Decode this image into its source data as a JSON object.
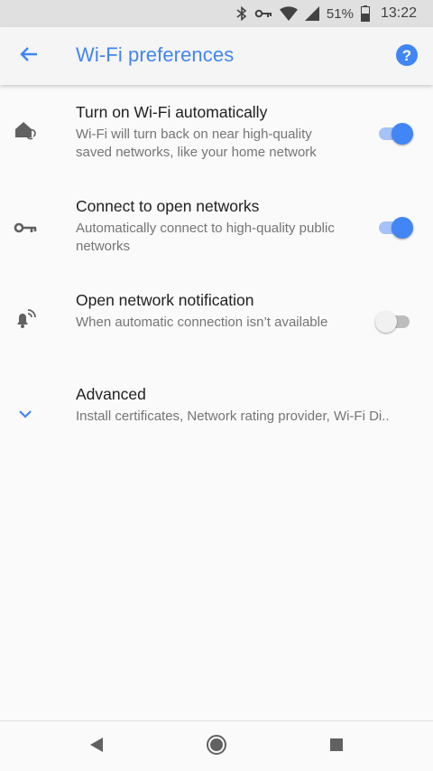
{
  "status_bar": {
    "battery_percent": "51%",
    "time": "13:22",
    "icons": [
      "bluetooth-icon",
      "vpn-key-icon",
      "wifi-icon",
      "signal-icon",
      "battery-icon"
    ]
  },
  "app_bar": {
    "title": "Wi-Fi preferences",
    "back_icon": "arrow-back-icon",
    "help_icon": "help-icon",
    "accent_color": "#4285f4"
  },
  "settings": [
    {
      "icon": "home-wifi-icon",
      "title": "Turn on Wi-Fi automatically",
      "summary": "Wi-Fi will turn back on near high-quality saved networks, like your home network",
      "switch_on": true
    },
    {
      "icon": "key-icon",
      "title": "Connect to open networks",
      "summary": "Automatically connect to high-quality public networks",
      "switch_on": true
    },
    {
      "icon": "notification-wifi-icon",
      "title": "Open network notification",
      "summary": "When automatic connection isn’t available",
      "switch_on": false
    },
    {
      "icon": "chevron-down-icon",
      "title": "Advanced",
      "summary": "Install certificates, Network rating provider, Wi‑Fi Di.."
    }
  ],
  "nav_bar": {
    "icons": [
      "back-triangle-icon",
      "home-circle-icon",
      "recents-square-icon"
    ]
  }
}
